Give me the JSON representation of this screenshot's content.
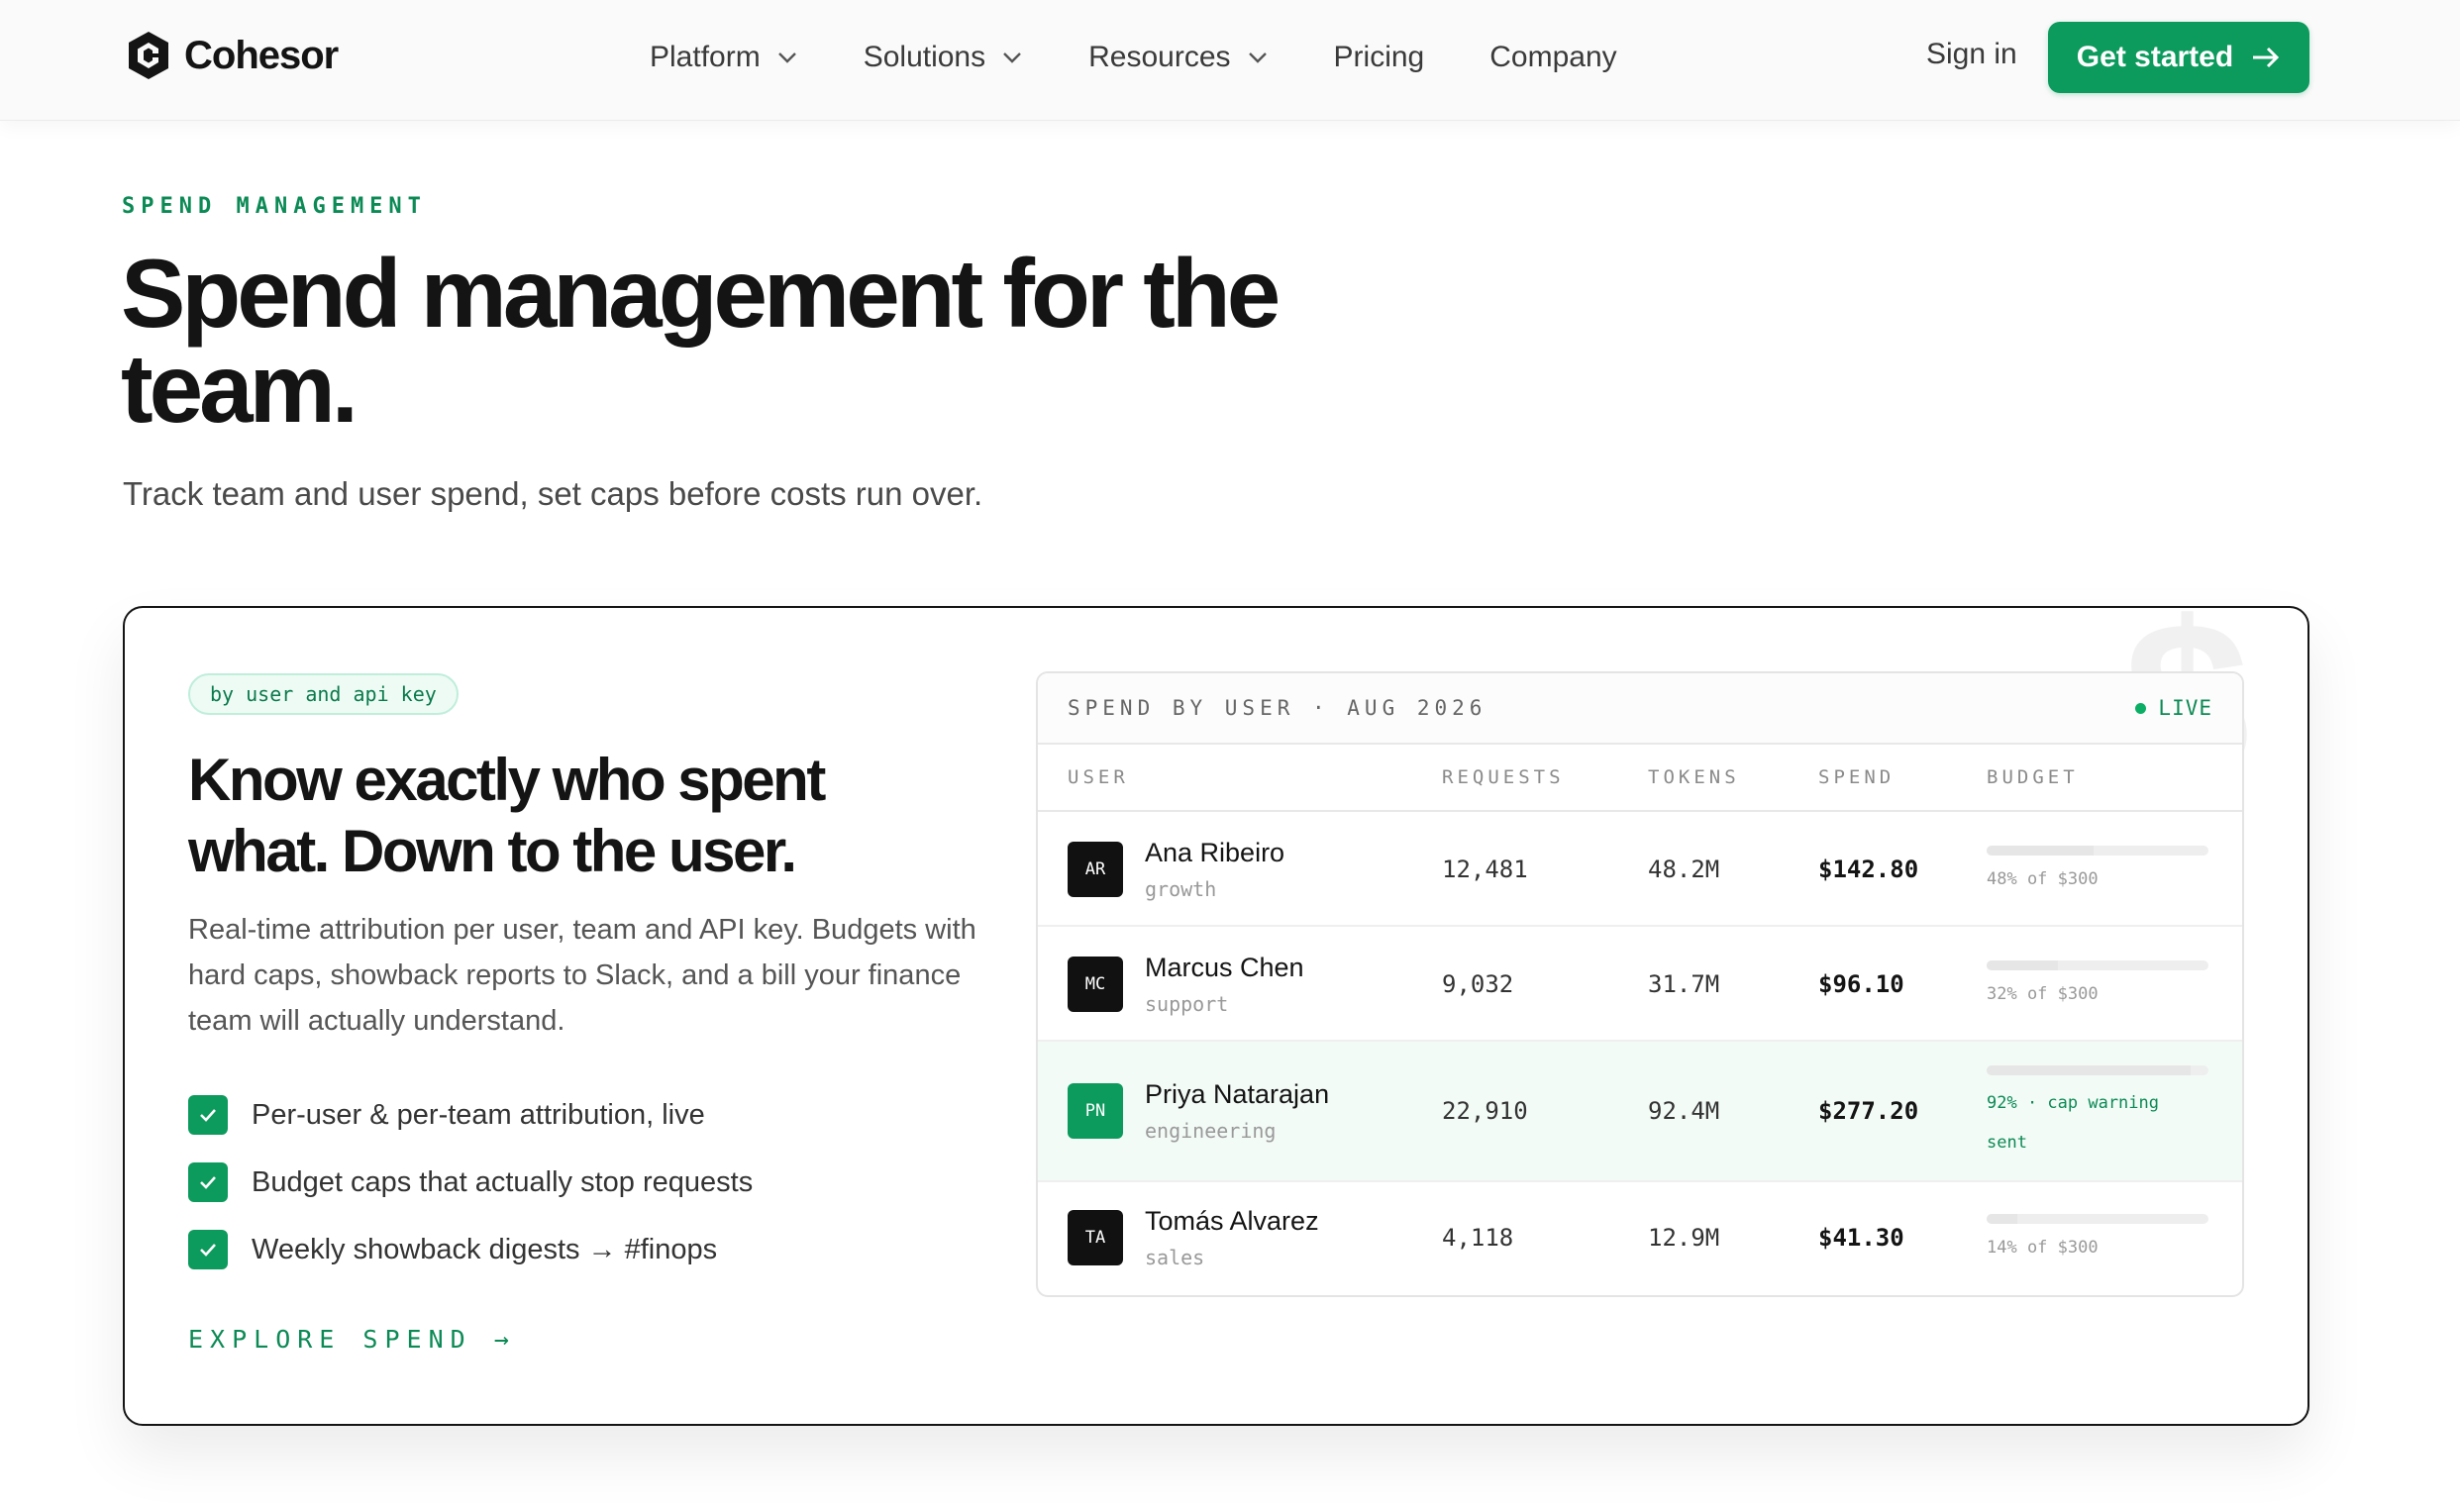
{
  "nav": {
    "brand": "Cohesor",
    "menu": [
      {
        "label": "Platform",
        "dropdown": true
      },
      {
        "label": "Solutions",
        "dropdown": true
      },
      {
        "label": "Resources",
        "dropdown": true
      },
      {
        "label": "Pricing",
        "dropdown": false
      },
      {
        "label": "Company",
        "dropdown": false
      }
    ],
    "signin": "Sign in",
    "cta": "Get started"
  },
  "hero": {
    "eyebrow": "SPEND MANAGEMENT",
    "title": "Spend management for the team.",
    "lead": "Track team and user spend, set caps before costs run over."
  },
  "feature": {
    "pill": "by user and api key",
    "title": "Know exactly who spent what. Down to the user.",
    "body": "Real-time attribution per user, team and API key. Budgets with hard caps, showback reports to Slack, and a bill your finance team will actually understand.",
    "checks": [
      "Per-user & per-team attribution, live",
      "Budget caps that actually stop requests",
      "Weekly showback digests → #finops"
    ],
    "explore": "EXPLORE SPEND →",
    "watermark": "$"
  },
  "table": {
    "title": "SPEND BY USER · AUG 2026",
    "live": "LIVE",
    "columns": [
      "USER",
      "REQUESTS",
      "TOKENS",
      "SPEND",
      "BUDGET"
    ],
    "rows": [
      {
        "initials": "AR",
        "name": "Ana Ribeiro",
        "team": "growth",
        "requests": "12,481",
        "tokens": "48.2M",
        "spend": "$142.80",
        "budget_pct": 48,
        "budget_note": "48% of $300",
        "warning": false
      },
      {
        "initials": "MC",
        "name": "Marcus Chen",
        "team": "support",
        "requests": "9,032",
        "tokens": "31.7M",
        "spend": "$96.10",
        "budget_pct": 32,
        "budget_note": "32% of $300",
        "warning": false
      },
      {
        "initials": "PN",
        "name": "Priya Natarajan",
        "team": "engineering",
        "requests": "22,910",
        "tokens": "92.4M",
        "spend": "$277.20",
        "budget_pct": 92,
        "budget_note": "92% · cap warning sent",
        "warning": true
      },
      {
        "initials": "TA",
        "name": "Tomás Alvarez",
        "team": "sales",
        "requests": "4,118",
        "tokens": "12.9M",
        "spend": "$41.30",
        "budget_pct": 14,
        "budget_note": "14% of $300",
        "warning": false
      }
    ]
  },
  "colors": {
    "accent": "#0c9a5d",
    "accent_text": "#0c8a55",
    "ink": "#141414"
  },
  "icons": {
    "logo": "hexagon-c-logo-icon",
    "chevron": "chevron-down-icon",
    "arrow": "arrow-right-icon",
    "check": "check-icon",
    "live": "live-dot-icon"
  }
}
